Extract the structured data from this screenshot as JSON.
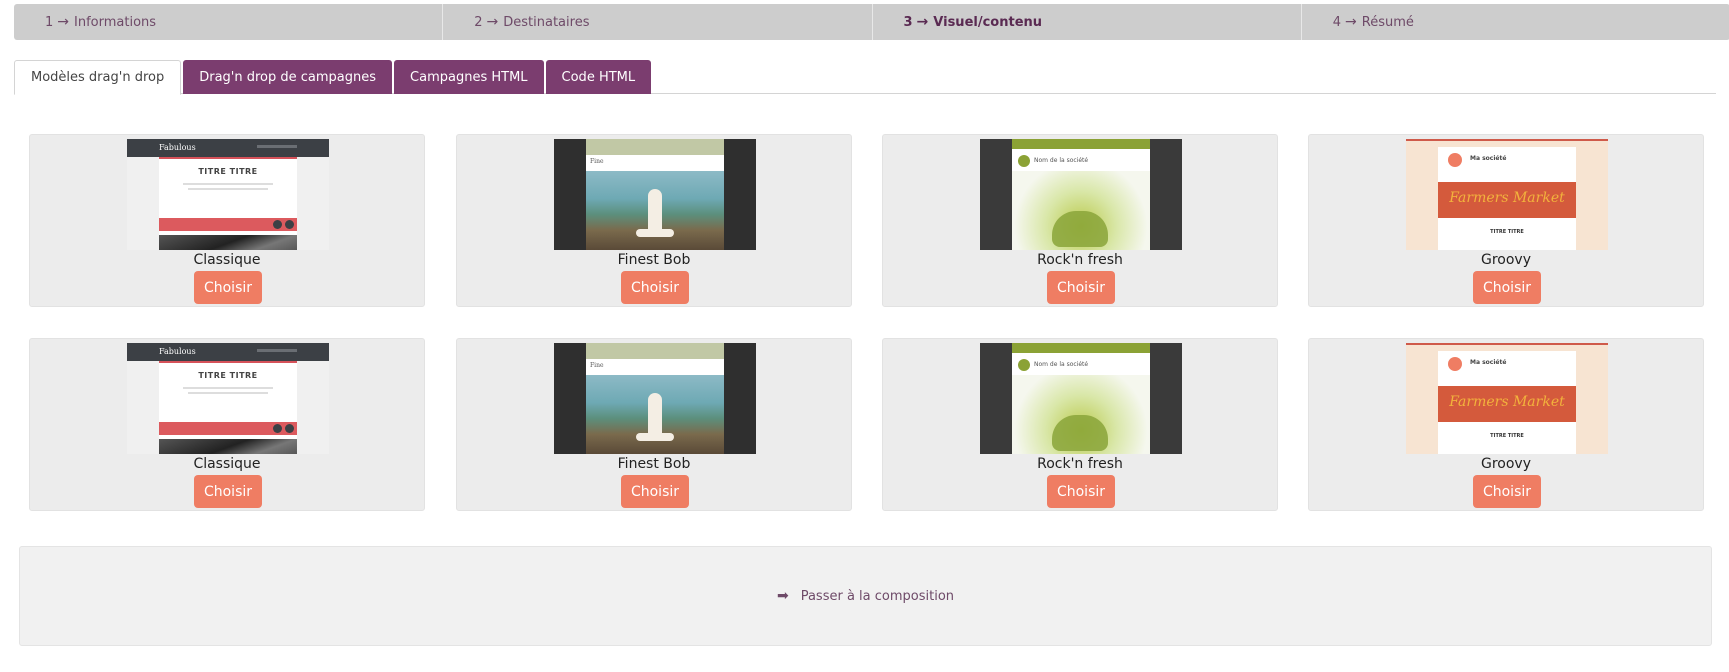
{
  "steps": [
    {
      "num": "1",
      "label": "Informations"
    },
    {
      "num": "2",
      "label": "Destinataires"
    },
    {
      "num": "3",
      "label": "Visuel/contenu"
    },
    {
      "num": "4",
      "label": "Résumé"
    }
  ],
  "step_arrow": "→",
  "tabs": [
    {
      "label": "Modèles drag'n drop"
    },
    {
      "label": "Drag'n drop de campagnes"
    },
    {
      "label": "Campagnes HTML"
    },
    {
      "label": "Code HTML"
    }
  ],
  "templates": {
    "choose_label": "Choisir",
    "row1": [
      "Classique",
      "Finest Bob",
      "Rock'n fresh",
      "Groovy"
    ],
    "row2": [
      "Classique",
      "Finest Bob",
      "Rock'n fresh",
      "Groovy"
    ]
  },
  "compose": {
    "arrow": "➡",
    "label": "Passer à la composition"
  },
  "colors": {
    "accent": "#7b3d6f",
    "button": "#ef7d63",
    "steps_bg": "#cdcdcd"
  }
}
